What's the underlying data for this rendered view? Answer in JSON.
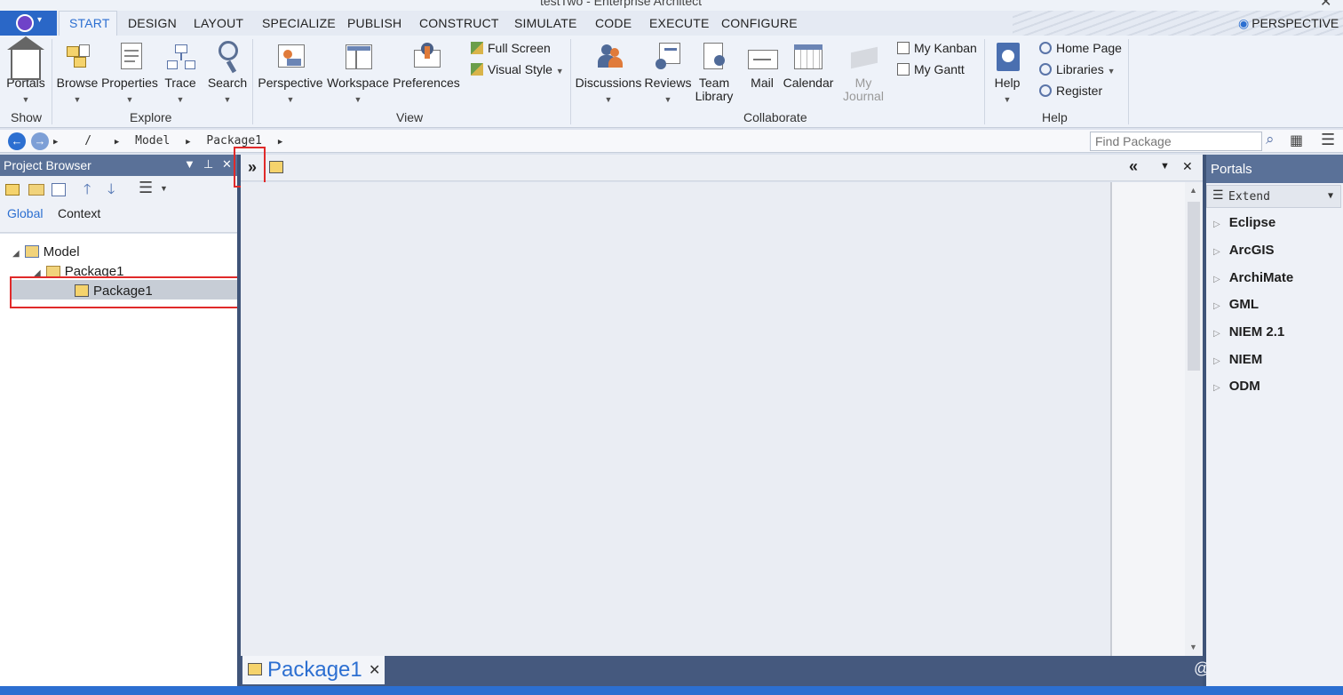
{
  "window": {
    "title": "testTwo - Enterprise Architect"
  },
  "menu": {
    "tabs": [
      "START",
      "DESIGN",
      "LAYOUT",
      "SPECIALIZE",
      "PUBLISH",
      "CONSTRUCT",
      "SIMULATE",
      "CODE",
      "EXECUTE",
      "CONFIGURE"
    ],
    "active_tab": "START",
    "perspective": "PERSPECTIVE"
  },
  "ribbon": {
    "show": {
      "portals": "Portals",
      "group": "Show"
    },
    "explore": {
      "browse": "Browse",
      "properties": "Properties",
      "trace": "Trace",
      "search": "Search",
      "group": "Explore"
    },
    "view": {
      "perspective": "Perspective",
      "workspace": "Workspace",
      "preferences": "Preferences",
      "full_screen": "Full Screen",
      "visual_style": "Visual Style",
      "group": "View"
    },
    "collaborate": {
      "discussions": "Discussions",
      "reviews": "Reviews",
      "team": "Team",
      "library": "Library",
      "mail": "Mail",
      "calendar": "Calendar",
      "my": "My",
      "journal": "Journal",
      "my_kanban": "My Kanban",
      "my_gantt": "My Gantt",
      "group": "Collaborate"
    },
    "help": {
      "help": "Help",
      "home_page": "Home Page",
      "libraries": "Libraries",
      "register": "Register",
      "group": "Help"
    }
  },
  "address_bar": {
    "crumbs": [
      "/",
      "Model",
      "Package1"
    ],
    "find_placeholder": "Find Package"
  },
  "project_browser": {
    "title": "Project Browser",
    "tabs": [
      "Global",
      "Context"
    ],
    "tree": [
      {
        "label": "Model"
      },
      {
        "label": "Package1"
      },
      {
        "label": "Package1",
        "selected": true
      }
    ]
  },
  "diagram": {
    "tab_label": "Package1"
  },
  "portals": {
    "title": "Portals",
    "dropdown": "Extend",
    "items": [
      "Eclipse",
      "ArcGIS",
      "ArchiMate",
      "GML",
      "NIEM 2.1",
      "NIEM",
      "ODM"
    ]
  },
  "watermark": "@稀土掘金技术社区",
  "colors": {
    "accent": "#2c6fd1",
    "panel_header": "#5a7198",
    "highlight": "#e02a2a"
  }
}
